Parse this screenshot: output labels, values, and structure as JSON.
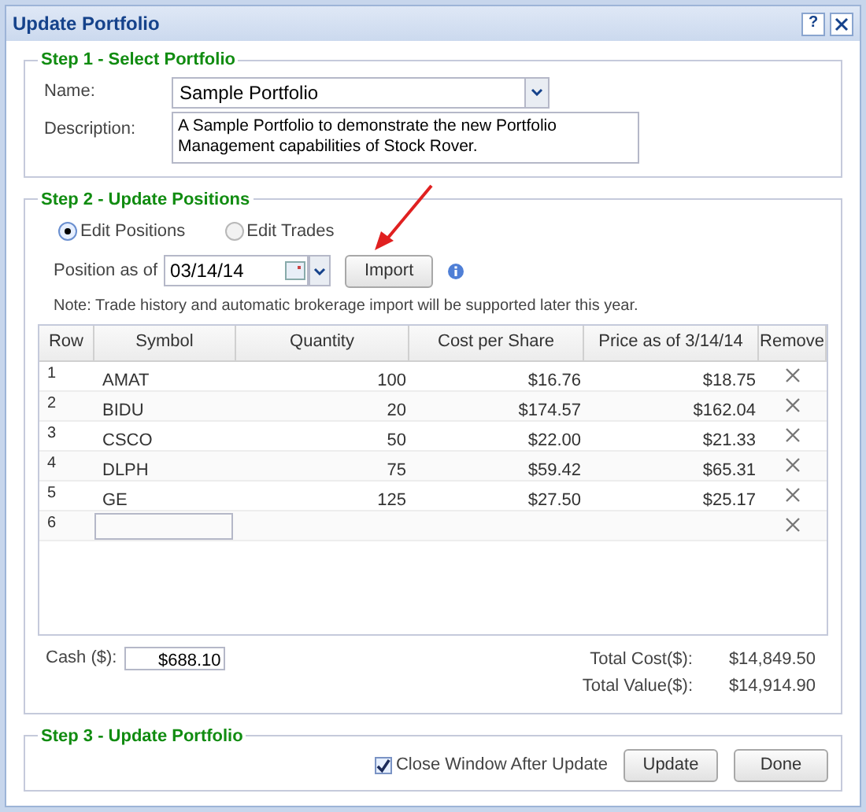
{
  "window": {
    "title": "Update Portfolio",
    "help": "?"
  },
  "step1": {
    "title": "Step 1 - Select Portfolio",
    "name_label": "Name:",
    "name_value": "Sample Portfolio",
    "description_label": "Description:",
    "description_value": "A Sample Portfolio to demonstrate the new Portfolio Management capabilities of Stock Rover."
  },
  "step2": {
    "title": "Step 2 - Update Positions",
    "modes": [
      {
        "label": "Edit Positions",
        "selected": true
      },
      {
        "label": "Edit Trades",
        "selected": false
      }
    ],
    "position_label": "Position as of",
    "date": "03/14/14",
    "import_button": "Import",
    "note": "Note: Trade history and automatic brokerage import will be supported later this year.",
    "table": {
      "columns": [
        "Row",
        "Symbol",
        "Quantity",
        "Cost per Share",
        "Price as of 3/14/14",
        "Remove"
      ],
      "rows": [
        {
          "kind": "position",
          "row": "1",
          "symbol": "AMAT",
          "quantity": "100",
          "cost": "$16.76",
          "price": "$18.75"
        },
        {
          "kind": "position",
          "row": "2",
          "symbol": "BIDU",
          "quantity": "20",
          "cost": "$174.57",
          "price": "$162.04"
        },
        {
          "kind": "position",
          "row": "3",
          "symbol": "CSCO",
          "quantity": "50",
          "cost": "$22.00",
          "price": "$21.33"
        },
        {
          "kind": "position",
          "row": "4",
          "symbol": "DLPH",
          "quantity": "75",
          "cost": "$59.42",
          "price": "$65.31"
        },
        {
          "kind": "position",
          "row": "5",
          "symbol": "GE",
          "quantity": "125",
          "cost": "$27.50",
          "price": "$25.17"
        },
        {
          "kind": "new",
          "row": "6"
        }
      ]
    },
    "cash_label": "Cash ($):",
    "cash_value": "$688.10",
    "totals": [
      {
        "label": "Total Cost($):",
        "value": "$14,849.50"
      },
      {
        "label": "Total Value($):",
        "value": "$14,914.90"
      }
    ]
  },
  "step3": {
    "title": "Step 3 - Update Portfolio",
    "close_after": {
      "label": "Close Window After Update",
      "checked": true
    },
    "buttons": [
      "Update",
      "Done"
    ]
  }
}
